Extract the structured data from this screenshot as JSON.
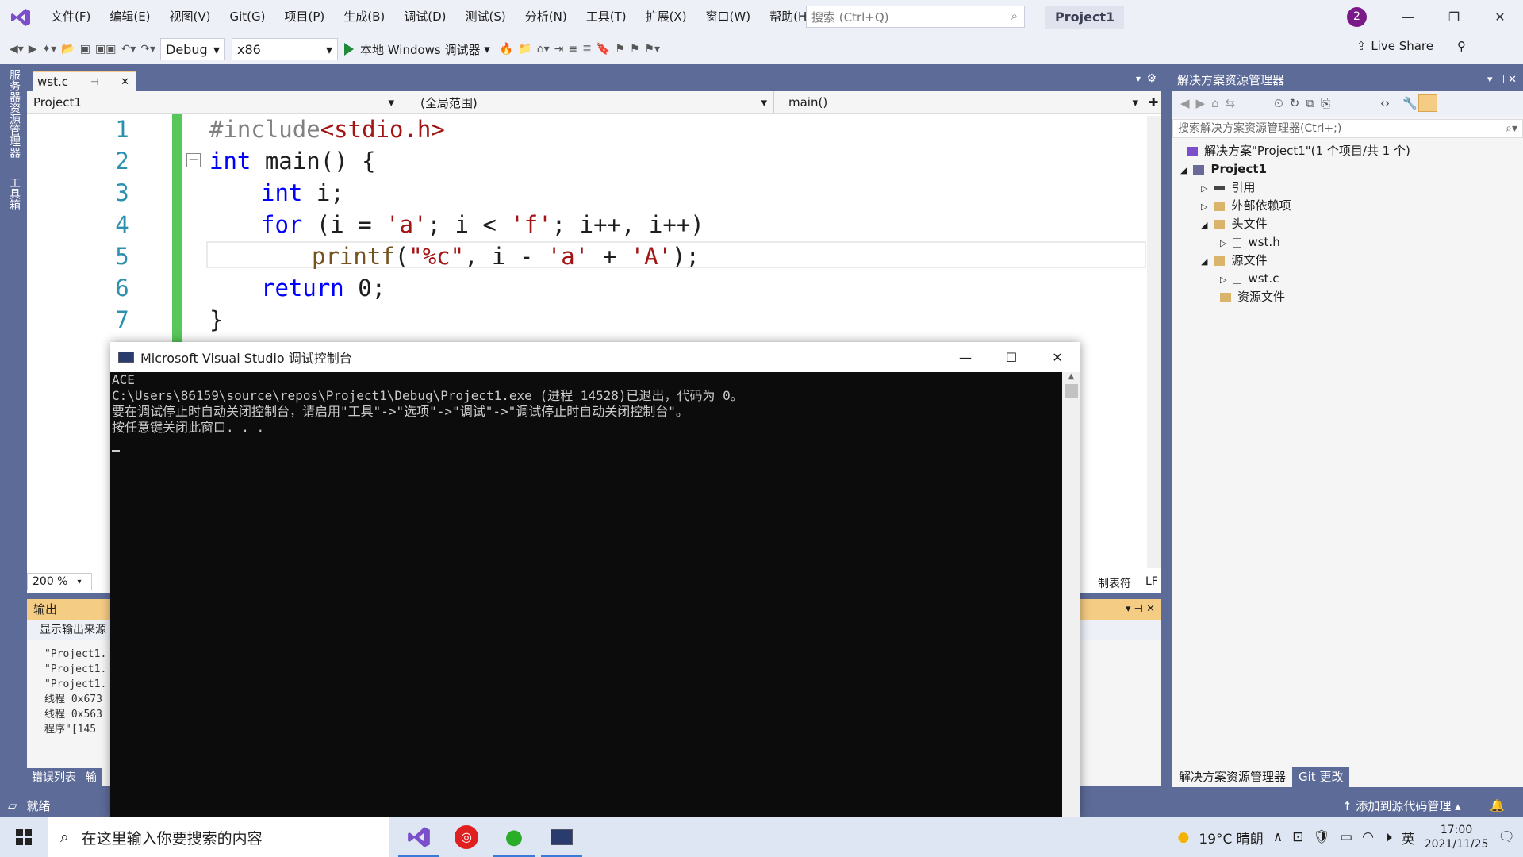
{
  "menu": [
    "文件(F)",
    "编辑(E)",
    "视图(V)",
    "Git(G)",
    "项目(P)",
    "生成(B)",
    "调试(D)",
    "测试(S)",
    "分析(N)",
    "工具(T)",
    "扩展(X)",
    "窗口(W)",
    "帮助(H)"
  ],
  "search": {
    "placeholder": "搜索 (Ctrl+Q)"
  },
  "project_title": "Project1",
  "avatar_badge": "2",
  "toolbar": {
    "config": "Debug",
    "platform": "x86",
    "run_label": "本地 Windows 调试器",
    "live_share": "Live Share"
  },
  "left_vtabs": [
    "服务器资源管理器",
    "工具箱"
  ],
  "doc_tab": "wst.c",
  "nav": {
    "project": "Project1",
    "scope": "(全局范围)",
    "member": "main()"
  },
  "code_lines": [
    {
      "n": "1"
    },
    {
      "n": "2"
    },
    {
      "n": "3"
    },
    {
      "n": "4"
    },
    {
      "n": "5"
    },
    {
      "n": "6"
    },
    {
      "n": "7"
    }
  ],
  "code": {
    "l1_pp": "#include",
    "l1_inc": "<stdio.h>",
    "l2_kw": "int",
    "l2_rest": " main() {",
    "l3_kw": "int",
    "l3_rest": " i;",
    "l4_kw": "for",
    "l4_a": " (i = ",
    "l4_s1": "'a'",
    "l4_b": "; i < ",
    "l4_s2": "'f'",
    "l4_c": "; i++, i++)",
    "l5_fn": "printf",
    "l5_a": "(",
    "l5_s1": "\"%c\"",
    "l5_b": ", i - ",
    "l5_s2": "'a'",
    "l5_c": " + ",
    "l5_s3": "'A'",
    "l5_d": ");",
    "l6_kw": "return",
    "l6_rest": " 0;",
    "l7": "}"
  },
  "zoom": "200 %",
  "editor_status": {
    "tabs": "制表符",
    "eol": "LF"
  },
  "solution": {
    "title": "解决方案资源管理器",
    "search_placeholder": "搜索解决方案资源管理器(Ctrl+;)",
    "items": [
      {
        "label": "解决方案\"Project1\"(1 个项目/共 1 个)"
      },
      {
        "label": "Project1"
      },
      {
        "label": "引用"
      },
      {
        "label": "外部依赖项"
      },
      {
        "label": "头文件"
      },
      {
        "label": "wst.h"
      },
      {
        "label": "源文件"
      },
      {
        "label": "wst.c"
      },
      {
        "label": "资源文件"
      }
    ],
    "tabs": [
      "解决方案资源管理器",
      "Git 更改"
    ]
  },
  "output": {
    "title": "输出",
    "source_label": "显示输出来源",
    "lines": [
      "\"Project1.",
      "\"Project1.",
      "\"Project1.",
      "线程 0x673",
      "线程 0x563",
      "程序\"[145"
    ]
  },
  "bottom_tabs": [
    "错误列表",
    "输"
  ],
  "status": {
    "ready": "就绪",
    "add_source": "添加到源代码管理"
  },
  "console": {
    "title": "Microsoft Visual Studio 调试控制台",
    "lines": [
      "ACE",
      "C:\\Users\\86159\\source\\repos\\Project1\\Debug\\Project1.exe (进程 14528)已退出，代码为 0。",
      "要在调试停止时自动关闭控制台，请启用\"工具\"->\"选项\"->\"调试\"->\"调试停止时自动关闭控制台\"。",
      "按任意键关闭此窗口. . ."
    ]
  },
  "taskbar": {
    "search_placeholder": "在这里输入你要搜索的内容",
    "weather": "19°C 晴朗",
    "ime": "英",
    "time": "17:00",
    "date": "2021/11/25"
  },
  "colors": {
    "accent": "#5d6b99",
    "tab_active": "#f5cc84",
    "green_margin": "#57c75a",
    "keyword": "#0000ff",
    "string": "#a31515"
  }
}
